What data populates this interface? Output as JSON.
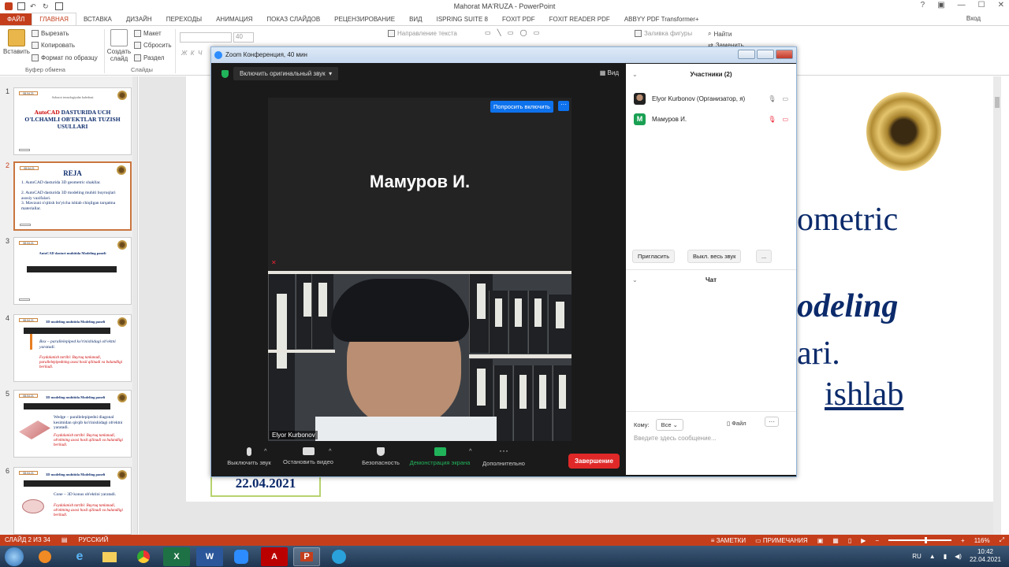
{
  "app": {
    "title": "Mahorat MA'RUZA  -  PowerPoint",
    "login": "Вход"
  },
  "ribbon": {
    "tabs": [
      "ФАЙЛ",
      "ГЛАВНАЯ",
      "ВСТАВКА",
      "ДИЗАЙН",
      "ПЕРЕХОДЫ",
      "АНИМАЦИЯ",
      "ПОКАЗ СЛАЙДОВ",
      "РЕЦЕНЗИРОВАНИЕ",
      "ВИД",
      "ISPRING SUITE 8",
      "FOXIT PDF",
      "FOXIT READER PDF",
      "ABBYY PDF Transformer+"
    ],
    "paste": "Вставить",
    "cut": "Вырезать",
    "copy": "Копировать",
    "format_painter": "Формат по образцу",
    "clipboard_group": "Буфер обмена",
    "new_slide": "Создать слайд",
    "layout": "Макет",
    "reset": "Сбросить",
    "section": "Раздел",
    "slides_group": "Слайды",
    "font_size": "40",
    "text_direction": "Направление текста",
    "shape_fill": "Заливка фигуры",
    "find": "Найти",
    "replace": "Заменить"
  },
  "thumbnails": [
    {
      "num": "1",
      "date": "08.04.21",
      "title_red": "AutoCAD",
      "title": " DASTURIDA UCH O'LCHAMLI OB'EKTLAR TUZISH USULLARI",
      "subtitle": "Axborot texnologiyalar kafedrasi"
    },
    {
      "num": "2",
      "date": "08.04.21",
      "title": "REJA",
      "items": [
        "1. AutoCAD dasturida 3D geometric shakllar.",
        "2. AutoCAD dasturida 3D modeling muhiti buyruqlari asosiy vazifalari.",
        "3. Mavzuni o'qitish bo'yicha ishlab chiqilgan tarqatma materiallar."
      ]
    },
    {
      "num": "3",
      "date": "08.04.21",
      "title": "AutoCAD dasturi muhitida Modeling paneli"
    },
    {
      "num": "4",
      "date": "08.04.21",
      "title": "3D modeling muhitida Modeling paneli",
      "text": "Box – parallelepiped ko'rinishidagi ob'ektni yaratadi.",
      "red": "Foydalanish tartibi: Buyruq tanlanadi, parallelepipedning asosi hosil qilinadi va balandligi beriladi."
    },
    {
      "num": "5",
      "date": "08.04.21",
      "title": "3D modeling muhitida Modeling paneli",
      "text": "Wedge – parallelepipedni diagonal kesimidan qirqib ko'rinishidagi ob'ektni yaratadi.",
      "red": "Foydalanish tartibi: Buyruq tanlanadi, ob'ektning asosi hosil qilinadi va balandligi beriladi."
    },
    {
      "num": "6",
      "date": "08.04.21",
      "title": "3D modeling muhitida Modeling paneli",
      "text": "Cone – 3D konus ob'ektini yaratadi.",
      "red": "Foydalanish tartibi: Buyruq tanlanadi, ob'ektning asosi hosil qilinadi va balandligi beriladi."
    }
  ],
  "slide": {
    "line1": "ometric",
    "line2": "odeling",
    "line3": "ari.",
    "line4": "ishlab",
    "date": "22.04.2021"
  },
  "zoom": {
    "title": "Zoom Конференция, 40 мин",
    "audio_button": "Включить оригинальный звук",
    "view_button": "Вид",
    "speaker_name": "Мамуров И.",
    "ask_unmute": "Попросить включить",
    "ask_more": "···",
    "video_label": "Elyor Kurbonov",
    "controls": {
      "mute": "Выключить звук",
      "video": "Остановить видео",
      "security": "Безопасность",
      "share": "Демонстрация экрана",
      "more": "Дополнительно",
      "end": "Завершение"
    },
    "participants_header": "Участники (2)",
    "participants": [
      {
        "name": "Elyor Kurbonov (Организатор, я)"
      },
      {
        "name": "Мамуров И.",
        "initial": "М"
      }
    ],
    "invite": "Пригласить",
    "mute_all": "Выкл. весь звук",
    "more": "...",
    "chat_header": "Чат",
    "chat_to": "Кому:",
    "chat_recipient": "Все",
    "chat_file": "Файл",
    "chat_dots": "···",
    "chat_placeholder": "Введите здесь сообщение..."
  },
  "status": {
    "slide_info": "СЛАЙД 2 ИЗ 34",
    "language": "РУССКИЙ",
    "notes": "ЗАМЕТКИ",
    "comments": "ПРИМЕЧАНИЯ",
    "zoom": "116%"
  },
  "taskbar": {
    "lang": "RU",
    "time": "10:42",
    "date": "22.04.2021"
  },
  "colors": {
    "ppt_accent": "#c43e1c",
    "slide_text": "#0b2a6b",
    "zoom_blue": "#0e72ed",
    "zoom_end": "#e02828",
    "share_green": "#21b35a"
  }
}
